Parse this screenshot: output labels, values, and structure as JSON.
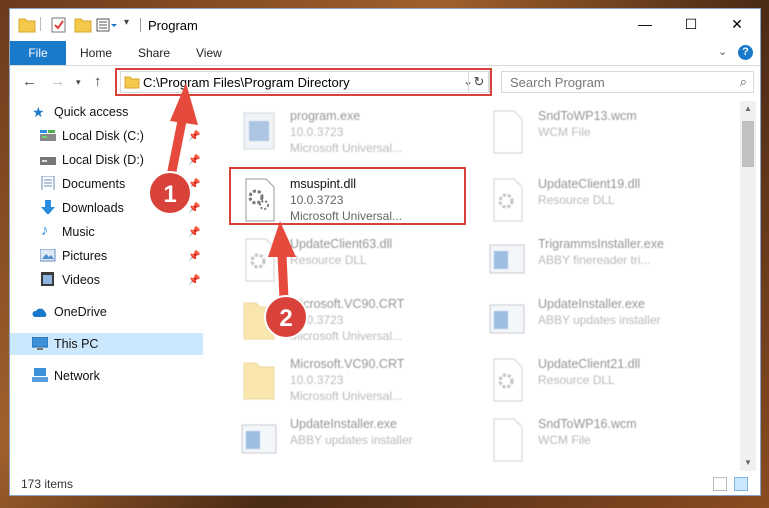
{
  "window": {
    "title": "Program",
    "controls": {
      "minimize": "—",
      "maximize": "☐",
      "close": "✕"
    }
  },
  "ribbon": {
    "tabs": [
      "File",
      "Home",
      "Share",
      "View"
    ],
    "help": "?"
  },
  "address": {
    "path": "C:\\Program Files\\Program Directory"
  },
  "search": {
    "placeholder": "Search Program"
  },
  "nav": {
    "quick_access": "Quick access",
    "items": [
      {
        "label": "Local Disk (C:)",
        "icon": "drive-icon",
        "pinned": true
      },
      {
        "label": "Local Disk (D:)",
        "icon": "drive-icon",
        "pinned": true
      },
      {
        "label": "Documents",
        "icon": "documents-icon",
        "pinned": true
      },
      {
        "label": "Downloads",
        "icon": "downloads-icon",
        "pinned": true
      },
      {
        "label": "Music",
        "icon": "music-icon",
        "pinned": true
      },
      {
        "label": "Pictures",
        "icon": "pictures-icon",
        "pinned": true
      },
      {
        "label": "Videos",
        "icon": "videos-icon",
        "pinned": true
      }
    ],
    "onedrive": "OneDrive",
    "this_pc": "This PC",
    "network": "Network"
  },
  "files": [
    {
      "name": "program.exe",
      "line1": "10.0.3723",
      "line2": "Microsoft Universal...",
      "icon": "exe-icon"
    },
    {
      "name": "SndToWP13.wcm",
      "line1": "WCM File",
      "line2": "",
      "icon": "blank-file-icon"
    },
    {
      "name": "msuspint.dll",
      "line1": "10.0.3723",
      "line2": "Microsoft Universal...",
      "icon": "dll-gear-icon"
    },
    {
      "name": "UpdateClient19.dll",
      "line1": "Resource DLL",
      "line2": "",
      "icon": "dll-gear-icon"
    },
    {
      "name": "UpdateClient63.dll",
      "line1": "Resource DLL",
      "line2": "",
      "icon": "dll-gear-icon"
    },
    {
      "name": "TrigrammsInstaller.exe",
      "line1": "ABBY finereader tri...",
      "line2": "",
      "icon": "installer-icon"
    },
    {
      "name": "Microsoft.VC90.CRT",
      "line1": "10.0.3723",
      "line2": "Microsoft Universal...",
      "icon": "folder-icon"
    },
    {
      "name": "UpdateInstaller.exe",
      "line1": "ABBY updates installer",
      "line2": "",
      "icon": "installer-icon"
    },
    {
      "name": "Microsoft.VC90.CRT",
      "line1": "10.0.3723",
      "line2": "Microsoft Universal...",
      "icon": "folder-icon"
    },
    {
      "name": "UpdateClient21.dll",
      "line1": "Resource DLL",
      "line2": "",
      "icon": "dll-gear-icon"
    },
    {
      "name": "UpdateInstaller.exe",
      "line1": "ABBY updates installer",
      "line2": "",
      "icon": "installer-icon"
    },
    {
      "name": "SndToWP16.wcm",
      "line1": "WCM File",
      "line2": "",
      "icon": "blank-file-icon"
    }
  ],
  "status": {
    "count": "173 items"
  },
  "callouts": [
    "1",
    "2"
  ],
  "colors": {
    "accent": "#1979ca",
    "highlight": "#d9413b",
    "selected": "#cce8ff"
  }
}
